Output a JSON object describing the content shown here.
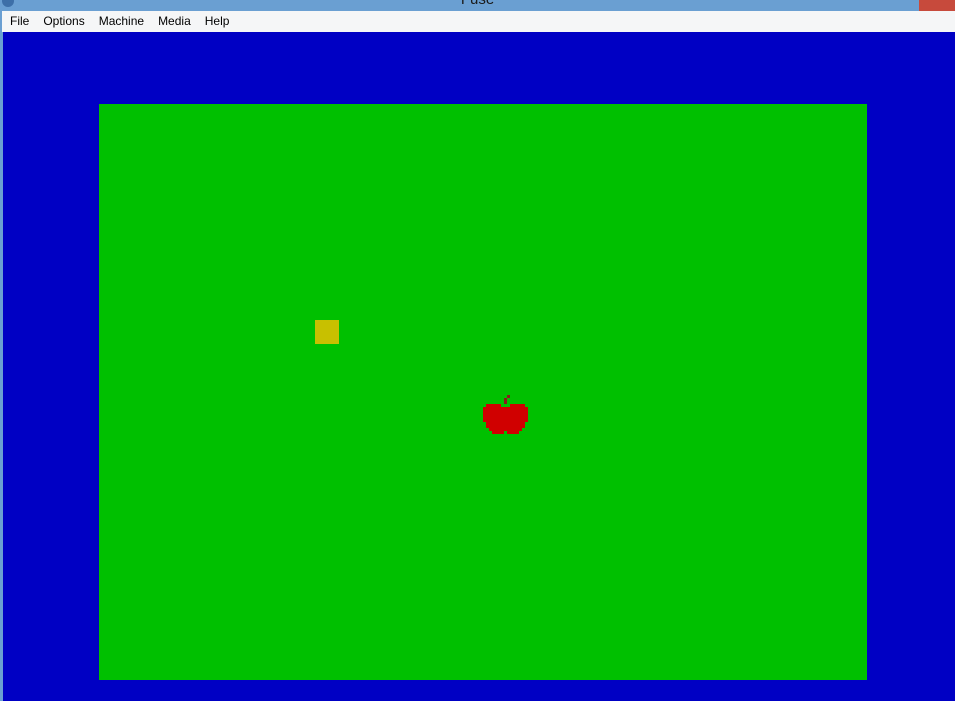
{
  "window": {
    "title": "Fuse"
  },
  "menu": {
    "items": [
      {
        "label": "File",
        "name": "menu-file"
      },
      {
        "label": "Options",
        "name": "menu-options"
      },
      {
        "label": "Machine",
        "name": "menu-machine"
      },
      {
        "label": "Media",
        "name": "menu-media"
      },
      {
        "label": "Help",
        "name": "menu-help"
      }
    ]
  },
  "game": {
    "border_color": "#0000c4",
    "paper_color": "#00c000",
    "snake_color": "#c8c000",
    "apple_color": "#d00000",
    "objects": [
      "snake-segment",
      "apple-icon"
    ]
  }
}
